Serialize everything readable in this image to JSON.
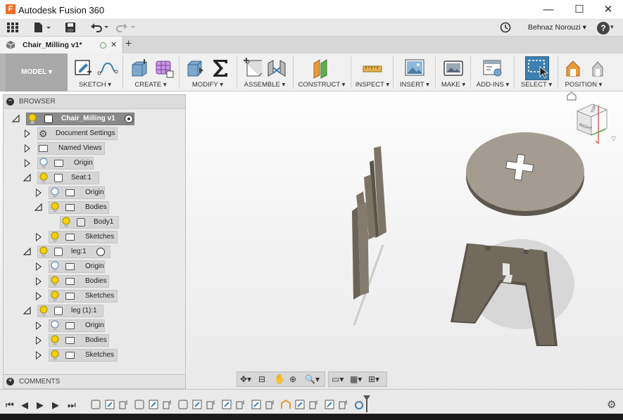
{
  "app": {
    "title": "Autodesk Fusion 360",
    "logo_letter": "F"
  },
  "window_controls": {
    "minimize": "—",
    "maximize": "☐",
    "close": "✕"
  },
  "quick_access": {
    "user": "Behnaz Norouzi",
    "help": "?"
  },
  "doc_tab": {
    "name": "Chair_Milling v1*",
    "close": "✕",
    "new_tab": "+"
  },
  "workspace": {
    "label": "MODEL"
  },
  "toolbar": {
    "groups": [
      {
        "label": "SKETCH",
        "icon": "sketch-icon"
      },
      {
        "label": "CREATE",
        "icon": "create-icon"
      },
      {
        "label": "MODIFY",
        "icon": "modify-icon"
      },
      {
        "label": "ASSEMBLE",
        "icon": "assemble-icon"
      },
      {
        "label": "CONSTRUCT",
        "icon": "construct-icon"
      },
      {
        "label": "INSPECT",
        "icon": "inspect-icon"
      },
      {
        "label": "INSERT",
        "icon": "insert-icon"
      },
      {
        "label": "MAKE",
        "icon": "make-icon"
      },
      {
        "label": "ADD-INS",
        "icon": "addins-icon"
      },
      {
        "label": "SELECT",
        "icon": "select-icon"
      },
      {
        "label": "POSITION",
        "icon": "position-icon"
      }
    ]
  },
  "browser": {
    "title": "BROWSER",
    "root": "Chair_Milling v1",
    "items": [
      {
        "label": "Document Settings"
      },
      {
        "label": "Named Views"
      },
      {
        "label": "Origin"
      },
      {
        "label": "Seat:1"
      },
      {
        "label": "Origin"
      },
      {
        "label": "Bodies"
      },
      {
        "label": "Body1"
      },
      {
        "label": "Sketches"
      },
      {
        "label": "leg:1"
      },
      {
        "label": "Origin"
      },
      {
        "label": "Bodies"
      },
      {
        "label": "Sketches"
      },
      {
        "label": "leg (1):1"
      },
      {
        "label": "Origin"
      },
      {
        "label": "Bodies"
      },
      {
        "label": "Sketches"
      }
    ]
  },
  "comments": {
    "title": "COMMENTS"
  },
  "viewcube": {
    "face_label": "RIGHT",
    "top_label": "TOP"
  },
  "colors": {
    "accent_select": "#3c7fb1",
    "model_bg": "#a8a8a8",
    "part": "#6e665c",
    "seat_top": "#a59c91"
  }
}
